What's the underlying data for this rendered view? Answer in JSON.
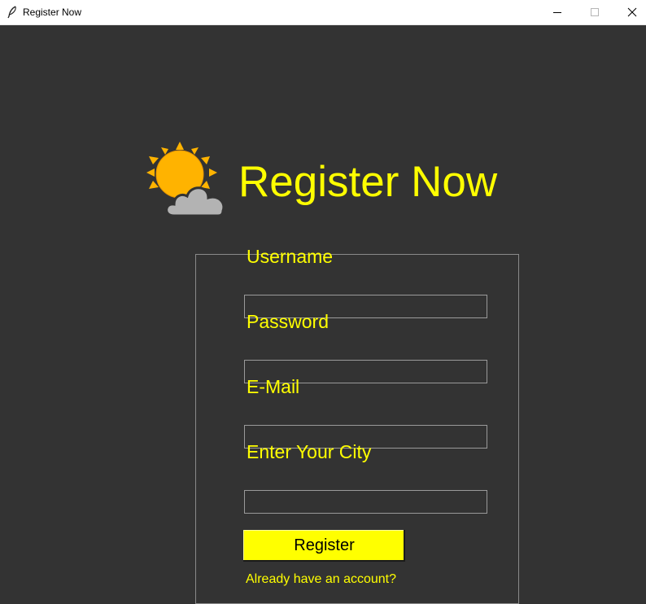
{
  "window": {
    "title": "Register Now",
    "icons": {
      "app": "feather-icon",
      "minimize": "minimize-icon",
      "maximize": "maximize-icon",
      "close": "close-icon"
    }
  },
  "header": {
    "title": "Register Now",
    "icon": "partly-cloudy-icon",
    "title_color": "#ffff00"
  },
  "form": {
    "fields": [
      {
        "label": "Username",
        "value": "",
        "placeholder": ""
      },
      {
        "label": "Password",
        "value": "",
        "placeholder": ""
      },
      {
        "label": "E-Mail",
        "value": "",
        "placeholder": ""
      },
      {
        "label": "Enter Your City",
        "value": "",
        "placeholder": ""
      }
    ],
    "submit_label": "Register",
    "login_link": "Already have an account?"
  },
  "colors": {
    "background": "#333333",
    "accent": "#ffff00",
    "sun": "#ffb300",
    "cloud": "#b0b0b0"
  }
}
